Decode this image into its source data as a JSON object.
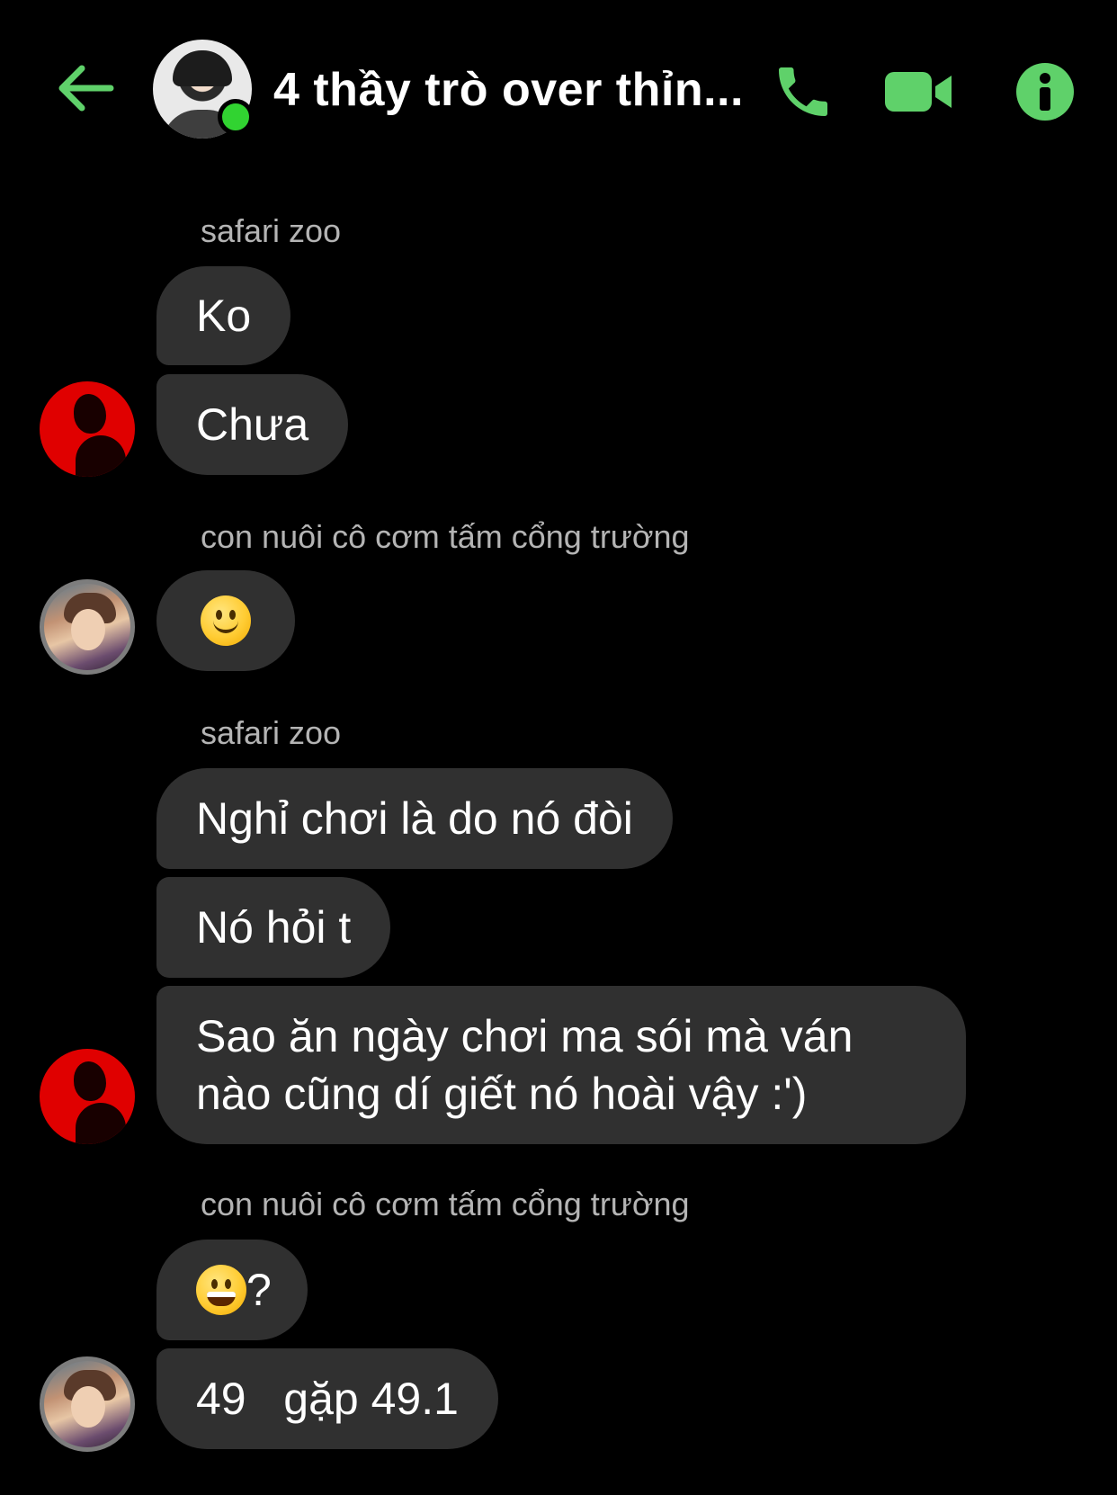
{
  "header": {
    "title": "4 thầy trò over thỉn...",
    "back_icon": "back-arrow-icon",
    "call_icon": "phone-icon",
    "video_icon": "video-camera-icon",
    "info_icon": "info-icon",
    "accent_color": "#5fd16a",
    "online_status_color": "#31d331"
  },
  "messages": [
    {
      "sender": "safari zoo",
      "texts": [
        "Ko",
        "Chưa"
      ]
    },
    {
      "sender": "con nuôi cô cơm tấm cổng trường",
      "emoji": "slightly-smiling-face"
    },
    {
      "sender": "safari zoo",
      "texts": [
        "Nghỉ chơi là do nó đòi",
        "Nó hỏi t",
        "Sao ăn ngày chơi ma sói mà ván nào cũng dí giết nó hoài vậy :')"
      ]
    },
    {
      "sender": "con nuôi cô cơm tấm cổng trường",
      "emoji_reply": {
        "emoji": "grinning-face",
        "suffix": "?"
      },
      "texts": [
        "49   gặp 49.1"
      ]
    }
  ]
}
